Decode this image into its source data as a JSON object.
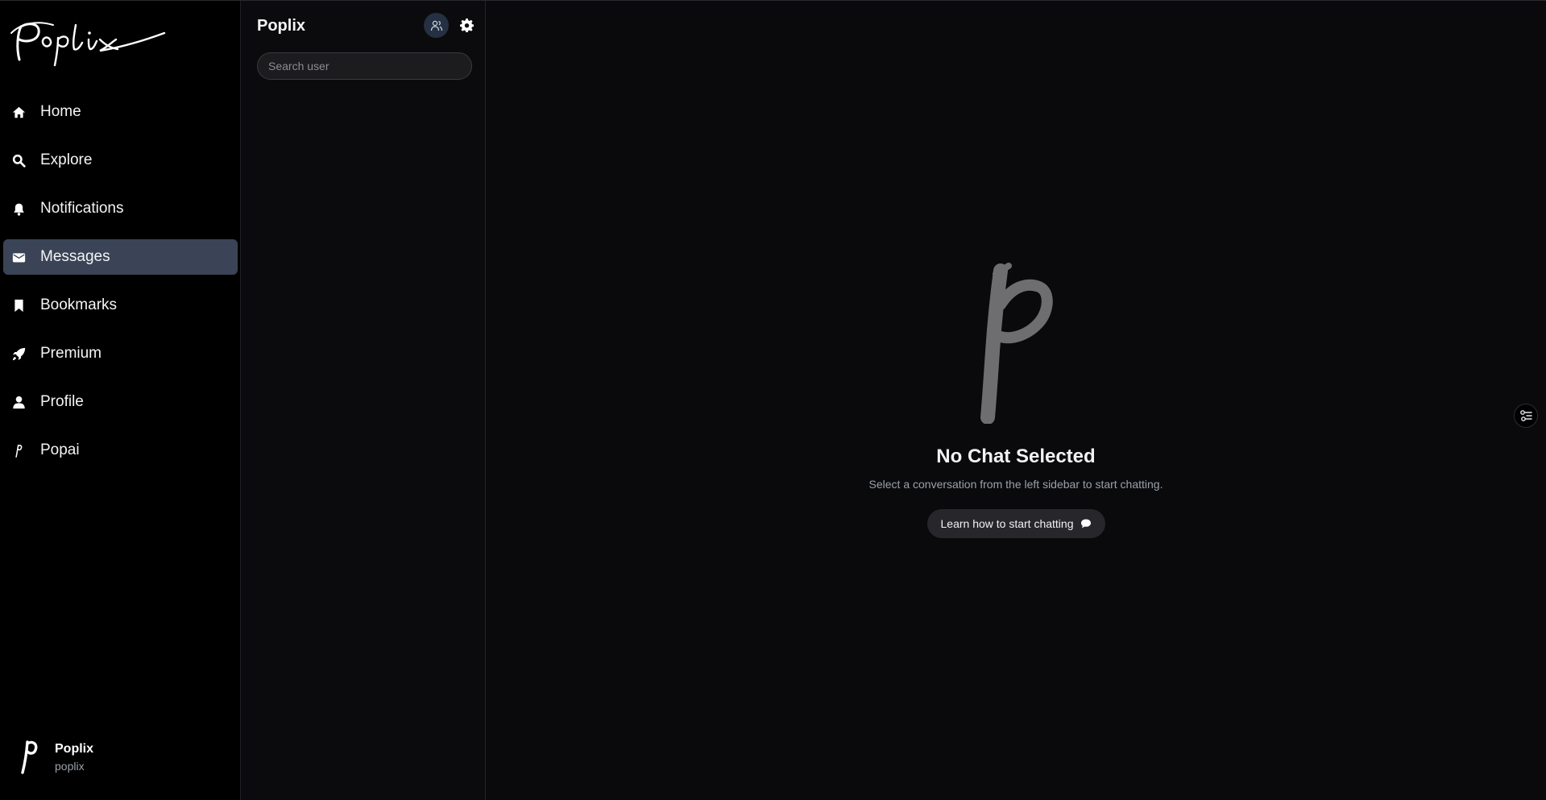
{
  "brand": {
    "logo_text": "Poplix"
  },
  "nav": {
    "items": [
      {
        "label": "Home",
        "icon": "home-icon",
        "active": false
      },
      {
        "label": "Explore",
        "icon": "search-icon",
        "active": false
      },
      {
        "label": "Notifications",
        "icon": "bell-icon",
        "active": false
      },
      {
        "label": "Messages",
        "icon": "envelope-icon",
        "active": true
      },
      {
        "label": "Bookmarks",
        "icon": "bookmark-icon",
        "active": false
      },
      {
        "label": "Premium",
        "icon": "rocket-icon",
        "active": false
      },
      {
        "label": "Profile",
        "icon": "user-icon",
        "active": false
      },
      {
        "label": "Popai",
        "icon": "popai-icon",
        "active": false
      }
    ]
  },
  "user": {
    "name": "Poplix",
    "handle": "poplix"
  },
  "chats": {
    "title": "Poplix",
    "search_placeholder": "Search user"
  },
  "main": {
    "empty_title": "No Chat Selected",
    "empty_subtitle": "Select a conversation from the left sidebar to start chatting.",
    "learn_button": "Learn how to start chatting"
  },
  "colors": {
    "active_nav": "#3a4456",
    "accent_icon_bg": "#253042",
    "main_bg": "#0a0a0c"
  }
}
